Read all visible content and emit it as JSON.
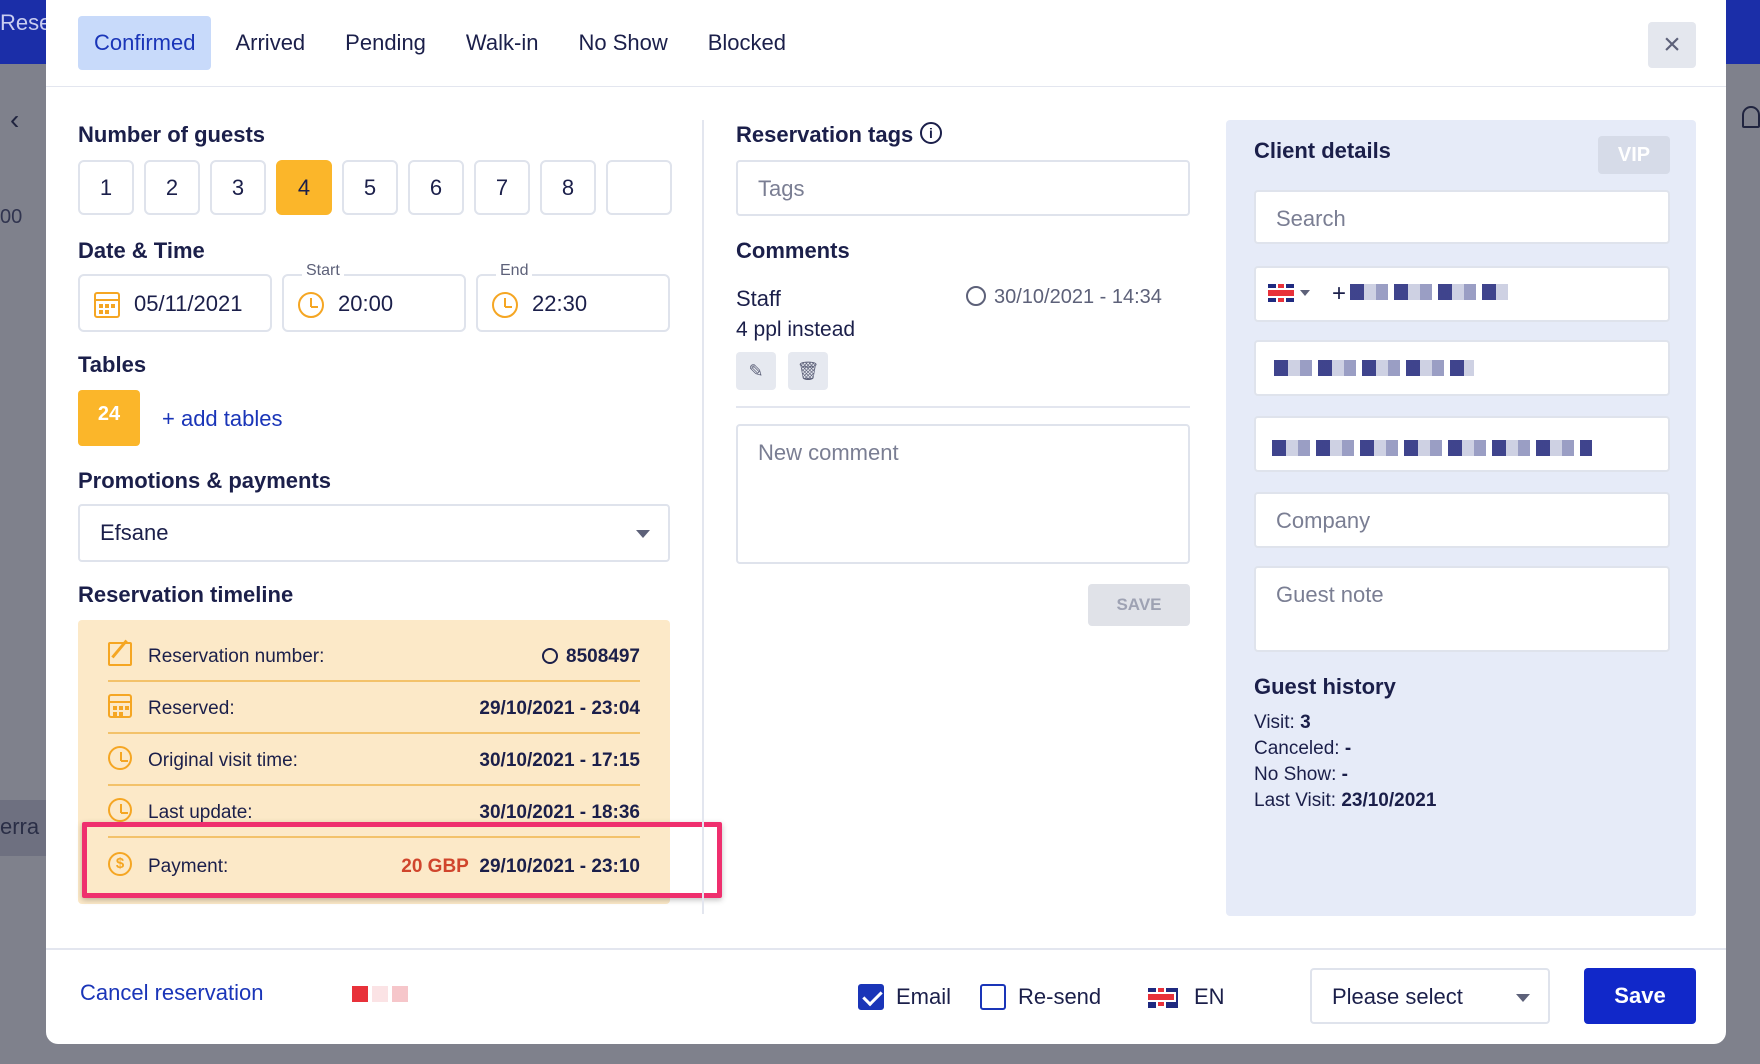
{
  "background": {
    "title": "Reser",
    "hour": "00",
    "side_text": "erra"
  },
  "tabs": [
    "Confirmed",
    "Arrived",
    "Pending",
    "Walk-in",
    "No Show",
    "Blocked"
  ],
  "close_icon": "×",
  "guests": {
    "label": "Number of guests",
    "options": [
      "1",
      "2",
      "3",
      "4",
      "5",
      "6",
      "7",
      "8"
    ],
    "selected": "4"
  },
  "datetime": {
    "label": "Date & Time",
    "date": "05/11/2021",
    "start_label": "Start",
    "start": "20:00",
    "end_label": "End",
    "end": "22:30"
  },
  "tables": {
    "label": "Tables",
    "table": "24",
    "add_label": "+ add tables"
  },
  "promotions": {
    "label": "Promotions & payments",
    "selected": "Efsane"
  },
  "timeline": {
    "label": "Reservation timeline",
    "rows": [
      {
        "label": "Reservation number:",
        "value": "8508497"
      },
      {
        "label": "Reserved:",
        "value": "29/10/2021 - 23:04"
      },
      {
        "label": "Original visit time:",
        "value": "30/10/2021 - 17:15"
      },
      {
        "label": "Last update:",
        "value": "30/10/2021 - 18:36"
      }
    ],
    "payment": {
      "label": "Payment:",
      "amount": "20 GBP",
      "value": "29/10/2021 - 23:10"
    }
  },
  "tags": {
    "label": "Reservation tags",
    "placeholder": "Tags",
    "info_icon": "i"
  },
  "comments": {
    "label": "Comments",
    "author": "Staff",
    "time": "30/10/2021 - 14:34",
    "text": "4 ppl instead",
    "edit_icon": "✎",
    "delete_icon": "🗑",
    "new_placeholder": "New comment",
    "save_label": "SAVE"
  },
  "client": {
    "label": "Client details",
    "vip": "VIP",
    "search_placeholder": "Search",
    "phone_prefix": "+",
    "company_placeholder": "Company",
    "note_placeholder": "Guest note"
  },
  "history": {
    "label": "Guest history",
    "visit_label": "Visit:",
    "visit": "3",
    "canceled_label": "Canceled:",
    "canceled": "-",
    "noshow_label": "No Show:",
    "noshow": "-",
    "last_label": "Last Visit:",
    "last": "23/10/2021"
  },
  "footer": {
    "cancel_label": "Cancel reservation",
    "email_label": "Email",
    "email_checked": true,
    "resend_label": "Re-send",
    "resend_checked": false,
    "language": "EN",
    "select_placeholder": "Please select",
    "save_label": "Save"
  },
  "colors": {
    "accent": "#1a35b8",
    "primary_button": "#1128c9",
    "selected_guest": "#fbb62a",
    "timeline_bg": "#fce9c8",
    "highlight": "#ef2f6e",
    "payment_amount": "#d0452c"
  }
}
